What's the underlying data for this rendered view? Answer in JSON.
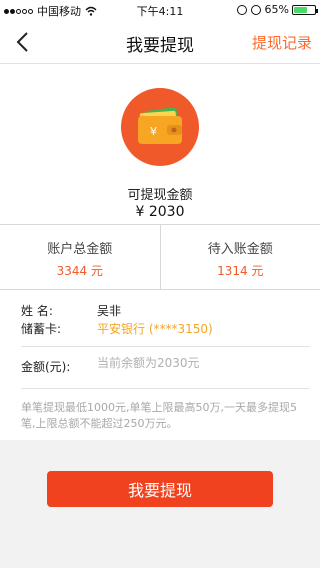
{
  "status_bar": {
    "carrier": "中国移动",
    "time": "下午4:11",
    "battery": "65%",
    "battery_level": 0.65
  },
  "nav": {
    "title": "我要提现",
    "action": "提现记录"
  },
  "summary": {
    "available_label": "可提现金额",
    "available_value": "¥ 2030"
  },
  "stats": [
    {
      "label": "账户总金额",
      "value": "3344 元"
    },
    {
      "label": "待入账金额",
      "value": "1314 元"
    }
  ],
  "account": {
    "name_label": "姓 名:",
    "name_value": "吴非",
    "card_label": "储蓄卡:",
    "card_value": "平安银行 (****3150)"
  },
  "amount": {
    "label": "金额(元):",
    "placeholder": "当前余额为2030元"
  },
  "note": "单笔提现最低1000元,单笔上限最高50万,一天最多提现5笔,上限总额不能超过250万元。",
  "submit_label": "我要提现",
  "colors": {
    "accent": "#f05a2a",
    "button": "#f0421f",
    "bank": "#f5a623"
  }
}
